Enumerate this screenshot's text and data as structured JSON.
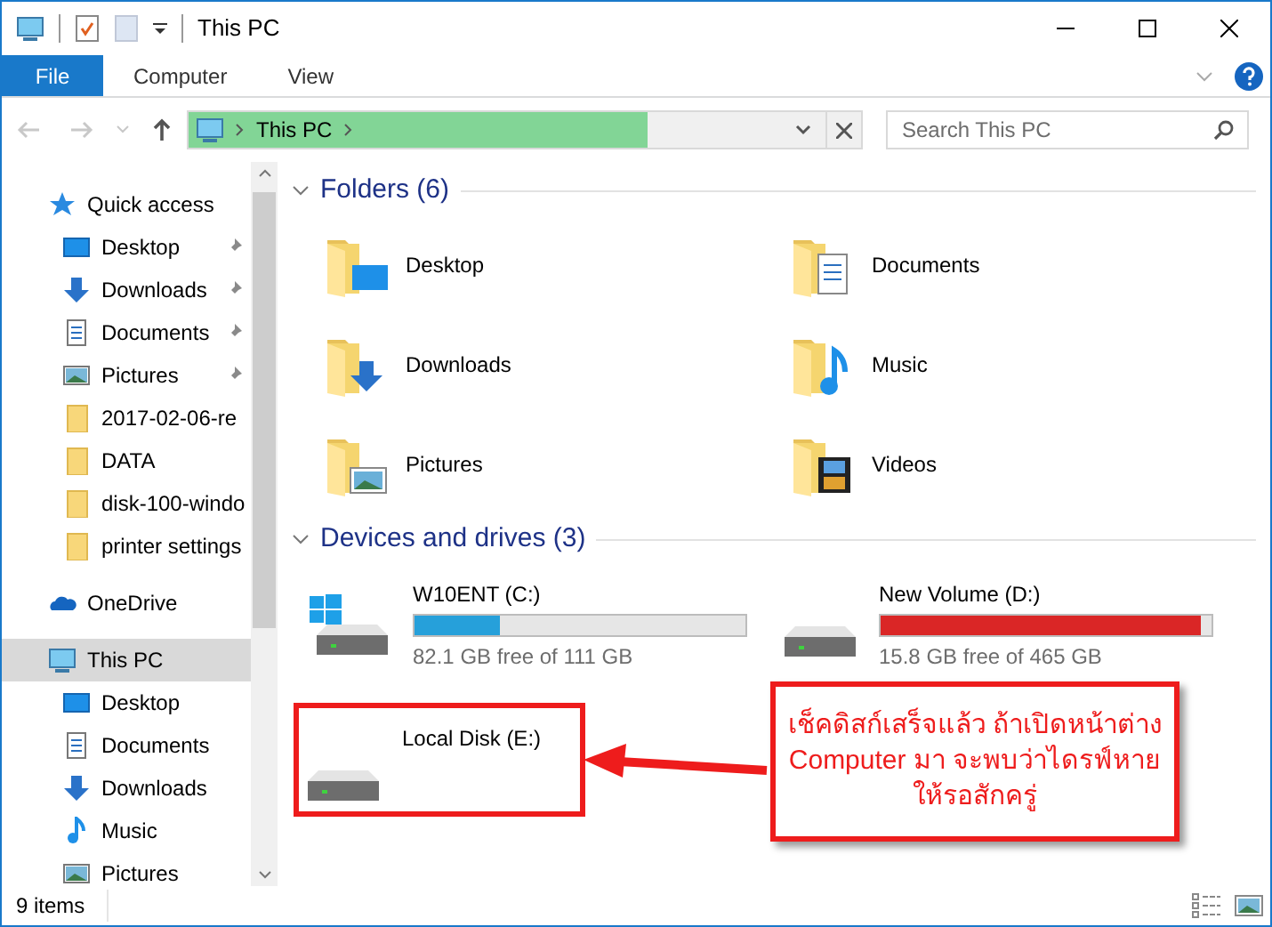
{
  "window": {
    "title": "This PC"
  },
  "ribbon_tabs": [
    {
      "label": "File",
      "selected": true
    },
    {
      "label": "Computer",
      "selected": false
    },
    {
      "label": "View",
      "selected": false
    }
  ],
  "address_bar": {
    "path": "This PC",
    "level": 0.72
  },
  "search": {
    "placeholder": "Search This PC"
  },
  "sidebar": {
    "items": [
      {
        "label": "Quick access",
        "kind": "star",
        "selected": false,
        "children": [
          {
            "label": "Desktop",
            "kind": "desktop",
            "pinned": true,
            "selected": false
          },
          {
            "label": "Downloads",
            "kind": "downloads",
            "pinned": true,
            "selected": false
          },
          {
            "label": "Documents",
            "kind": "documents",
            "pinned": true,
            "selected": false
          },
          {
            "label": "Pictures",
            "kind": "pictures",
            "pinned": true,
            "selected": false
          },
          {
            "label": "2017-02-06-re",
            "kind": "folder",
            "pinned": false,
            "selected": false
          },
          {
            "label": "DATA",
            "kind": "folder",
            "pinned": false,
            "selected": false
          },
          {
            "label": "disk-100-windo",
            "kind": "folder",
            "pinned": false,
            "selected": false
          },
          {
            "label": "printer settings",
            "kind": "folder",
            "pinned": false,
            "selected": false
          }
        ]
      },
      {
        "label": "OneDrive",
        "kind": "cloud",
        "selected": false
      },
      {
        "label": "This PC",
        "kind": "pc",
        "selected": true,
        "children": [
          {
            "label": "Desktop",
            "kind": "desktop",
            "pinned": false,
            "selected": false
          },
          {
            "label": "Documents",
            "kind": "documents",
            "pinned": false,
            "selected": false
          },
          {
            "label": "Downloads",
            "kind": "downloads",
            "pinned": false,
            "selected": false
          },
          {
            "label": "Music",
            "kind": "music",
            "pinned": false,
            "selected": false
          },
          {
            "label": "Pictures",
            "kind": "pictures",
            "pinned": false,
            "selected": false
          }
        ]
      }
    ]
  },
  "folders": {
    "heading": "Folders (6)",
    "expanded": true,
    "items": [
      {
        "label": "Desktop",
        "kind": "desktop"
      },
      {
        "label": "Documents",
        "kind": "documents"
      },
      {
        "label": "Downloads",
        "kind": "downloads"
      },
      {
        "label": "Music",
        "kind": "music"
      },
      {
        "label": "Pictures",
        "kind": "pictures"
      },
      {
        "label": "Videos",
        "kind": "videos"
      }
    ]
  },
  "drives": {
    "heading": "Devices and drives (3)",
    "expanded": true,
    "items": [
      {
        "label": "W10ENT (C:)",
        "kind": "system",
        "free": "82.1 GB free of 111 GB",
        "level": 0.26,
        "color": "#26a0da",
        "highlighted": false
      },
      {
        "label": "New Volume (D:)",
        "kind": "disk",
        "free": "15.8 GB free of 465 GB",
        "level": 0.97,
        "color": "#da2626",
        "highlighted": false
      },
      {
        "label": "Local Disk (E:)",
        "kind": "disk",
        "highlighted": true
      }
    ]
  },
  "annotation": {
    "text": "เช็คดิสก์เสร็จแล้ว ถ้าเปิดหน้าต่าง\nComputer มา จะพบว่าไดรฟ์หาย\nให้รอสักครู่"
  },
  "status_bar": {
    "count": "9 items"
  }
}
